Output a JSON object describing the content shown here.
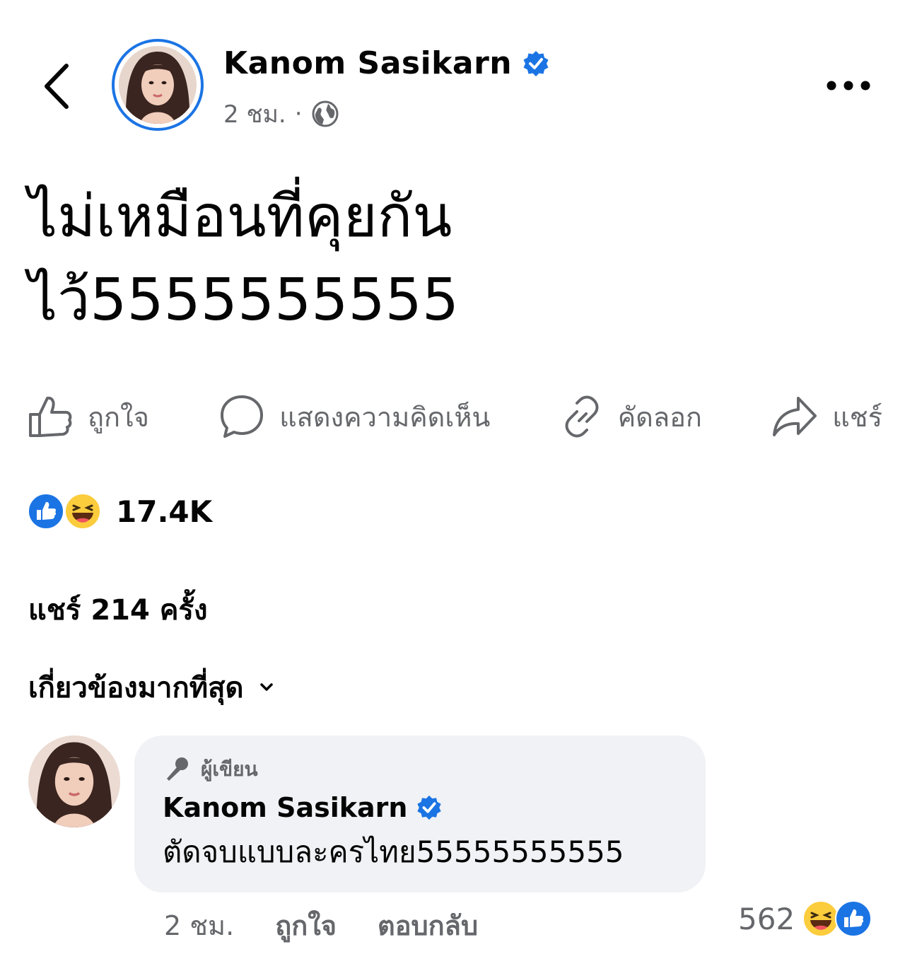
{
  "header": {
    "author_name": "Kanom Sasikarn",
    "time": "2 ชม.",
    "separator": "·",
    "privacy_icon": "globe-icon",
    "verified_icon": "verified-badge-icon",
    "more_icon": "more-dots-icon",
    "back_icon": "chevron-left-icon"
  },
  "post": {
    "text": "ไม่เหมือนที่คุยกัน\nไว้5555555555"
  },
  "actions": {
    "like": "ถูกใจ",
    "comment": "แสดงความคิดเห็น",
    "copy": "คัดลอก",
    "share": "แชร์"
  },
  "reactions": {
    "count": "17.4K",
    "types": [
      "like",
      "haha"
    ]
  },
  "shares": "แชร์ 214 ครั้ง",
  "comments_sort": "เกี่ยวข้องมากที่สุด",
  "comment": {
    "badge": "ผู้เขียน",
    "author": "Kanom Sasikarn",
    "text": "ตัดจบแบบละครไทย55555555555",
    "time": "2 ชม.",
    "like": "ถูกใจ",
    "reply": "ตอบกลับ",
    "reaction_count": "562"
  },
  "colors": {
    "accent": "#1b74e4",
    "secondary_text": "#65676b",
    "bubble": "#f0f2f5"
  }
}
